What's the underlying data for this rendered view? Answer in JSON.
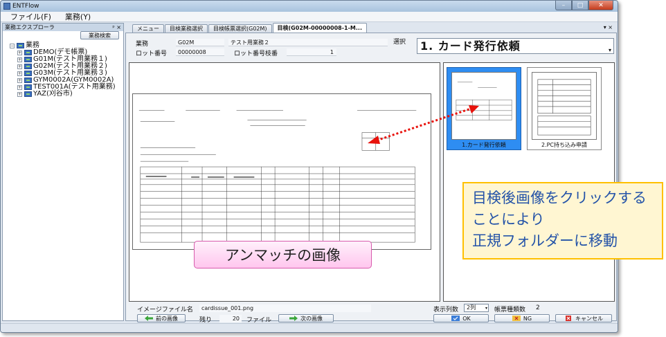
{
  "window": {
    "title": "ENTFlow",
    "controls": {
      "minimize": "–",
      "maximize": "□",
      "close": "✕"
    }
  },
  "menubar": {
    "items": [
      {
        "label": "ファイル(F)"
      },
      {
        "label": "業務(Y)"
      }
    ]
  },
  "explorer": {
    "title": "業務エクスプローラ",
    "pin": "ᵖ ×",
    "search_button": "業務検索",
    "root": {
      "label": "業務",
      "expander": "−"
    },
    "items": [
      {
        "label": "DEMO(デモ帳票)",
        "expander": "+"
      },
      {
        "label": "G01M(テスト用業務１)",
        "expander": "+"
      },
      {
        "label": "G02M(テスト用業務２)",
        "expander": "+"
      },
      {
        "label": "G03M(テスト用業務３)",
        "expander": "+"
      },
      {
        "label": "GYM0002A(GYM0002A)",
        "expander": "+"
      },
      {
        "label": "TEST001A(テスト用業務)",
        "expander": "+"
      },
      {
        "label": "YAZ(刈谷市)",
        "expander": "+"
      }
    ]
  },
  "tabs": {
    "items": [
      {
        "label": "メニュー"
      },
      {
        "label": "目検業務選択"
      },
      {
        "label": "目検帳票選択(G02M)"
      },
      {
        "label": "目検(G02M-00000008-1-M..."
      }
    ],
    "controls": "▾ ×"
  },
  "form": {
    "gyomu_label": "業務",
    "gyomu_code": "G02M",
    "gyomu_name": "テスト用業務２",
    "lot_label": "ロット番号",
    "lot_value": "00000008",
    "lot_branch_label": "ロット番号枝番",
    "lot_branch_value": "1",
    "select_label": "選択",
    "select_value": "1. カード発行依頼"
  },
  "thumbnails": [
    {
      "caption": "1.カード発行依頼"
    },
    {
      "caption": "2.PC持ち込み申請"
    }
  ],
  "footer": {
    "image_file_label": "イメージファイル名",
    "image_file_value": "cardissue_001.png",
    "columns_label": "表示列数",
    "columns_value": "2列",
    "form_types_label": "帳票種類数",
    "form_types_value": "2",
    "prev_button": "前の画像",
    "remain_label": "残り",
    "remain_value": "20",
    "file_label": "ファイル",
    "next_button": "次の画像",
    "ok_button": "OK",
    "ng_button": "NG",
    "cancel_button": "キャンセル"
  },
  "callouts": {
    "unmatched": "アンマッチの画像",
    "instruction_lines": [
      "目検後画像をクリックする",
      "ことにより",
      "正規フォルダーに移動"
    ]
  },
  "colors": {
    "selected_thumb": "#2e8df2",
    "arrow": "#e8120c",
    "callout_text": "#2453a8",
    "callout_border": "#ffc000",
    "pink_border": "#d75aac"
  }
}
